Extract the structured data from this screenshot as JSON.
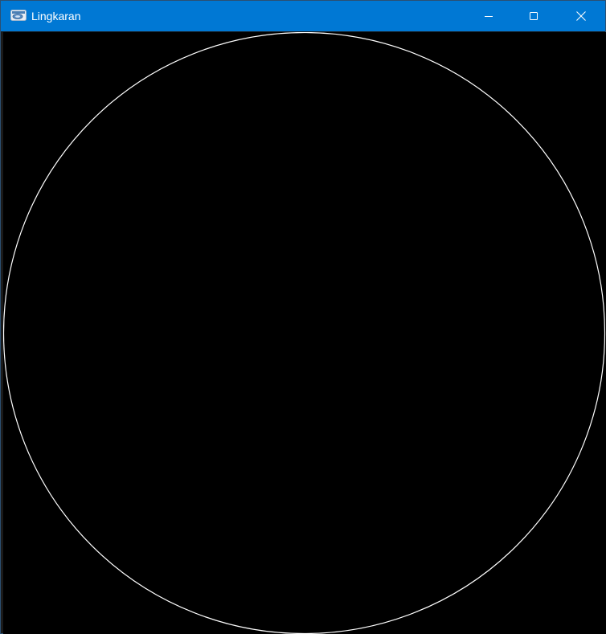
{
  "window": {
    "title": "Lingkaran",
    "app_icon": "application-window-icon",
    "controls": {
      "minimize_icon": "minimize-icon",
      "maximize_icon": "maximize-icon",
      "close_icon": "close-icon"
    }
  },
  "colors": {
    "titlebar_bg": "#0078d4",
    "titlebar_text": "#ffffff",
    "canvas_bg": "#000000",
    "circle_stroke": "#ffffff"
  },
  "canvas": {
    "shape": "circle"
  }
}
